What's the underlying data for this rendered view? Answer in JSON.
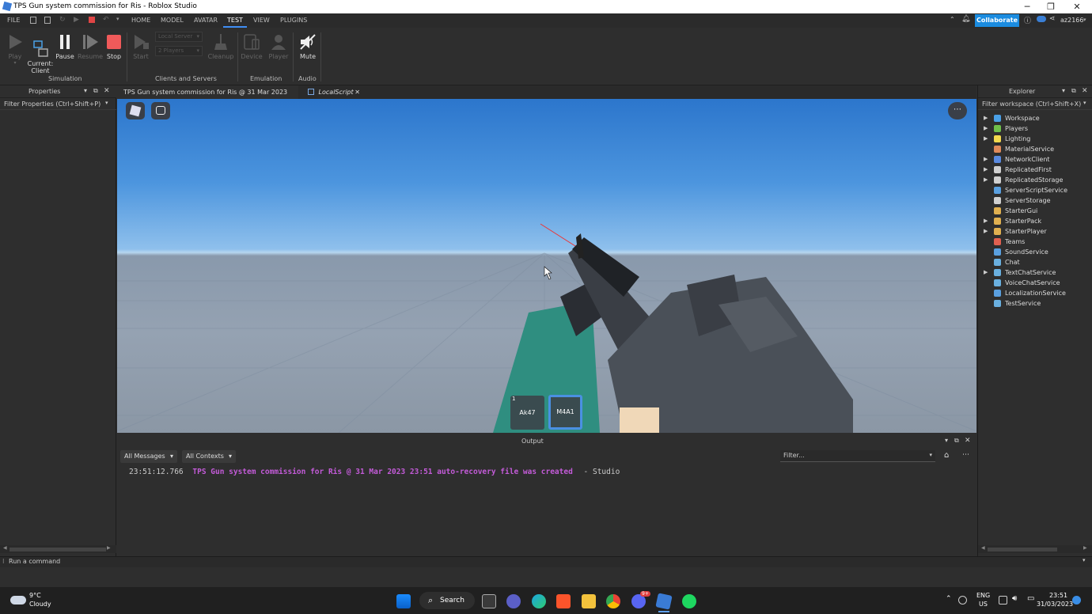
{
  "window": {
    "title": "TPS Gun system commission for Ris - Roblox Studio",
    "minimize": "─",
    "maximize": "❐",
    "close": "✕"
  },
  "menubar": {
    "file": "FILE",
    "tabs": [
      "HOME",
      "MODEL",
      "AVATAR",
      "TEST",
      "VIEW",
      "PLUGINS"
    ],
    "collaborate": "Collaborate",
    "user": "az2166"
  },
  "ribbon": {
    "play": "Play",
    "current_client": "Current:\nClient",
    "pause": "Pause",
    "resume": "Resume",
    "stop": "Stop",
    "start": "Start",
    "local_server": "Local Server",
    "players_count": "2 Players",
    "cleanup": "Cleanup",
    "device": "Device",
    "player": "Player",
    "mute": "Mute",
    "groups": {
      "simulation": "Simulation",
      "clients_servers": "Clients and Servers",
      "emulation": "Emulation",
      "audio": "Audio"
    }
  },
  "properties": {
    "title": "Properties",
    "filter": "Filter Properties (Ctrl+Shift+P)"
  },
  "tabs": [
    {
      "label": "TPS Gun system commission for Ris @ 31 Mar 2023 23:51"
    },
    {
      "label": "LocalScript"
    }
  ],
  "explorer": {
    "title": "Explorer",
    "filter": "Filter workspace (Ctrl+Shift+X)",
    "items": [
      {
        "label": "Workspace",
        "expandable": true,
        "color": "#4aa0e6"
      },
      {
        "label": "Players",
        "expandable": true,
        "color": "#6fbf4a"
      },
      {
        "label": "Lighting",
        "expandable": true,
        "color": "#f2d94e"
      },
      {
        "label": "MaterialService",
        "expandable": false,
        "color": "#e08a5a"
      },
      {
        "label": "NetworkClient",
        "expandable": true,
        "color": "#5a8ae0"
      },
      {
        "label": "ReplicatedFirst",
        "expandable": true,
        "color": "#d0d0d0"
      },
      {
        "label": "ReplicatedStorage",
        "expandable": true,
        "color": "#d0d0d0"
      },
      {
        "label": "ServerScriptService",
        "expandable": false,
        "color": "#5aa0e0"
      },
      {
        "label": "ServerStorage",
        "expandable": false,
        "color": "#d0d0d0"
      },
      {
        "label": "StarterGui",
        "expandable": false,
        "color": "#e0b050"
      },
      {
        "label": "StarterPack",
        "expandable": true,
        "color": "#e0b050"
      },
      {
        "label": "StarterPlayer",
        "expandable": true,
        "color": "#e0b050"
      },
      {
        "label": "Teams",
        "expandable": false,
        "color": "#e06050"
      },
      {
        "label": "SoundService",
        "expandable": false,
        "color": "#5aa0e0"
      },
      {
        "label": "Chat",
        "expandable": false,
        "color": "#6ab0e0"
      },
      {
        "label": "TextChatService",
        "expandable": true,
        "color": "#6ab0e0"
      },
      {
        "label": "VoiceChatService",
        "expandable": false,
        "color": "#6ab0e0"
      },
      {
        "label": "LocalizationService",
        "expandable": false,
        "color": "#5aa0e0"
      },
      {
        "label": "TestService",
        "expandable": false,
        "color": "#6ab0e0"
      }
    ]
  },
  "hotbar": [
    {
      "slot": "1",
      "label": "Ak47",
      "selected": false
    },
    {
      "slot": "",
      "label": "M4A1",
      "selected": true
    }
  ],
  "output": {
    "title": "Output",
    "messages_filter": "All Messages",
    "contexts_filter": "All Contexts",
    "filter_placeholder": "Filter...",
    "lines": [
      {
        "time": "23:51:12.766",
        "text": "TPS Gun system commission for Ris @ 31 Mar 2023 23:51 auto-recovery file was created",
        "source": "-  Studio"
      }
    ]
  },
  "command": {
    "placeholder": "Run a command"
  },
  "taskbar": {
    "weather_temp": "9°C",
    "weather_desc": "Cloudy",
    "search": "Search",
    "lang": "ENG",
    "region": "US",
    "time": "23:51",
    "date": "31/03/2023",
    "discord_badge": "9+"
  }
}
